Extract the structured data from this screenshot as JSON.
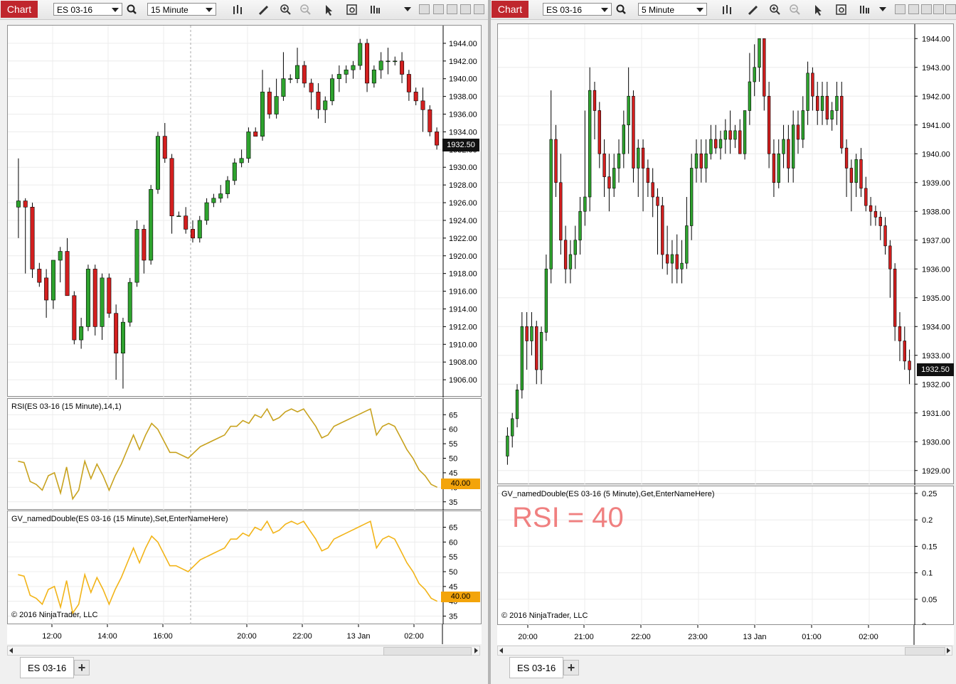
{
  "left": {
    "toolbar": {
      "chart_btn": "Chart",
      "instrument": "ES 03-16",
      "interval": "15 Minute"
    },
    "price_pane": {
      "ticks": [
        "1944.00",
        "1942.00",
        "1940.00",
        "1938.00",
        "1936.00",
        "1934.00",
        "1932.00",
        "1930.00",
        "1928.00",
        "1926.00",
        "1924.00",
        "1922.00",
        "1920.00",
        "1918.00",
        "1916.00",
        "1914.00",
        "1912.00",
        "1910.00",
        "1908.00",
        "1906.00"
      ],
      "last_price": "1932.50"
    },
    "rsi_pane": {
      "title": "RSI(ES 03-16 (15 Minute),14,1)",
      "ticks": [
        "65",
        "60",
        "55",
        "50",
        "45",
        "40",
        "35"
      ],
      "last": "40.00"
    },
    "gv_pane": {
      "title": "GV_namedDouble(ES 03-16 (15 Minute),Set,EnterNameHere)",
      "ticks": [
        "65",
        "60",
        "55",
        "50",
        "45",
        "40",
        "35"
      ],
      "last": "40.00",
      "copyright": "© 2016 NinjaTrader, LLC"
    },
    "time_labels": [
      "12:00",
      "14:00",
      "16:00",
      "20:00",
      "22:00",
      "13 Jan",
      "02:00"
    ],
    "tab": "ES 03-16",
    "add_tab": "+"
  },
  "right": {
    "toolbar": {
      "chart_btn": "Chart",
      "instrument": "ES 03-16",
      "interval": "5 Minute"
    },
    "price_pane": {
      "ticks": [
        "1944.00",
        "1943.00",
        "1942.00",
        "1941.00",
        "1940.00",
        "1939.00",
        "1938.00",
        "1937.00",
        "1936.00",
        "1935.00",
        "1934.00",
        "1933.00",
        "1932.00",
        "1931.00",
        "1930.00",
        "1929.00"
      ],
      "last_price": "1932.50"
    },
    "gv_pane": {
      "title": "GV_namedDouble(ES 03-16 (5 Minute),Get,EnterNameHere)",
      "ticks": [
        "0.25",
        "0.2",
        "0.15",
        "0.1",
        "0.05",
        "0"
      ],
      "annotation": "RSI = 40",
      "copyright": "© 2016 NinjaTrader, LLC"
    },
    "time_labels": [
      "20:00",
      "21:00",
      "22:00",
      "23:00",
      "13 Jan",
      "01:00",
      "02:00"
    ],
    "tab": "ES 03-16",
    "add_tab": "+"
  },
  "colors": {
    "up": "#2ea32e",
    "down": "#d31f1f",
    "rsi": "#c8a21e",
    "gv": "#f2b418",
    "marker": "#f3a40a",
    "annotation": "#f08080"
  },
  "chart_data": [
    {
      "type": "candlestick",
      "instrument": "ES 03-16",
      "interval": "15 Minute",
      "ylim": [
        1904,
        1946
      ],
      "candles": [
        [
          1925.5,
          1931.0,
          1922.0,
          1926.2
        ],
        [
          1926.2,
          1926.5,
          1918.0,
          1925.5
        ],
        [
          1925.5,
          1926.0,
          1917.5,
          1918.5
        ],
        [
          1918.5,
          1919.2,
          1916.5,
          1917.0
        ],
        [
          1917.5,
          1918.5,
          1913.0,
          1915.0
        ],
        [
          1915.0,
          1919.5,
          1914.0,
          1919.5
        ],
        [
          1919.5,
          1921.0,
          1917.0,
          1920.5
        ],
        [
          1920.5,
          1922.0,
          1919.0,
          1915.5
        ],
        [
          1915.5,
          1916.0,
          1910.0,
          1910.5
        ],
        [
          1910.5,
          1913.0,
          1909.5,
          1912.0
        ],
        [
          1912.0,
          1919.0,
          1911.5,
          1918.5
        ],
        [
          1918.5,
          1919.0,
          1911.0,
          1912.0
        ],
        [
          1912.0,
          1918.0,
          1910.5,
          1917.5
        ],
        [
          1917.5,
          1918.0,
          1913.0,
          1913.5
        ],
        [
          1913.5,
          1914.5,
          1906.0,
          1909.0
        ],
        [
          1909.0,
          1913.0,
          1905.0,
          1912.5
        ],
        [
          1912.5,
          1917.5,
          1912.0,
          1917.0
        ],
        [
          1917.0,
          1924.0,
          1916.5,
          1923.0
        ],
        [
          1923.0,
          1923.5,
          1918.0,
          1919.5
        ],
        [
          1919.5,
          1928.0,
          1919.0,
          1927.5
        ],
        [
          1927.5,
          1934.0,
          1927.0,
          1933.5
        ],
        [
          1933.5,
          1935.0,
          1930.5,
          1931.0
        ],
        [
          1931.0,
          1931.5,
          1922.5,
          1924.5
        ],
        [
          1924.5,
          1925.0,
          1924.5,
          1924.5
        ],
        [
          1924.5,
          1925.5,
          1922.5,
          1923.0
        ],
        [
          1923.0,
          1924.0,
          1921.5,
          1922.0
        ],
        [
          1922.0,
          1924.5,
          1921.5,
          1924.0
        ],
        [
          1924.0,
          1926.5,
          1923.5,
          1926.0
        ],
        [
          1926.0,
          1927.0,
          1925.5,
          1926.5
        ],
        [
          1926.5,
          1928.0,
          1926.0,
          1927.0
        ],
        [
          1927.0,
          1929.0,
          1926.5,
          1928.5
        ],
        [
          1928.5,
          1931.0,
          1928.0,
          1930.5
        ],
        [
          1930.5,
          1932.0,
          1930.0,
          1931.0
        ],
        [
          1931.0,
          1934.5,
          1930.5,
          1934.0
        ],
        [
          1934.0,
          1934.5,
          1933.5,
          1933.5
        ],
        [
          1933.5,
          1941.0,
          1933.0,
          1938.5
        ],
        [
          1938.5,
          1939.0,
          1935.5,
          1936.0
        ],
        [
          1936.0,
          1940.0,
          1935.5,
          1938.0
        ],
        [
          1938.0,
          1943.0,
          1937.5,
          1940.0
        ],
        [
          1940.0,
          1940.5,
          1939.5,
          1940.0
        ],
        [
          1940.0,
          1943.5,
          1939.5,
          1941.5
        ],
        [
          1941.5,
          1942.0,
          1939.0,
          1939.5
        ],
        [
          1939.5,
          1940.0,
          1936.5,
          1938.5
        ],
        [
          1938.5,
          1939.5,
          1935.5,
          1936.5
        ],
        [
          1936.5,
          1938.0,
          1935.0,
          1937.5
        ],
        [
          1937.5,
          1940.5,
          1937.0,
          1940.0
        ],
        [
          1940.0,
          1941.5,
          1938.5,
          1940.5
        ],
        [
          1940.5,
          1941.5,
          1939.5,
          1941.0
        ],
        [
          1941.0,
          1942.0,
          1940.0,
          1941.5
        ],
        [
          1941.5,
          1944.5,
          1941.0,
          1944.0
        ],
        [
          1944.0,
          1944.5,
          1938.5,
          1939.5
        ],
        [
          1939.5,
          1941.5,
          1939.0,
          1941.0
        ],
        [
          1941.0,
          1943.0,
          1940.0,
          1942.0
        ],
        [
          1942.0,
          1943.5,
          1940.5,
          1942.0
        ],
        [
          1942.0,
          1942.5,
          1941.5,
          1942.0
        ],
        [
          1942.0,
          1943.0,
          1939.5,
          1940.5
        ],
        [
          1940.5,
          1941.0,
          1937.5,
          1938.5
        ],
        [
          1938.5,
          1939.0,
          1937.0,
          1937.5
        ],
        [
          1937.5,
          1939.0,
          1934.0,
          1936.5
        ],
        [
          1936.5,
          1937.0,
          1933.5,
          1934.0
        ],
        [
          1934.0,
          1934.5,
          1932.0,
          1932.5
        ]
      ]
    },
    {
      "type": "line",
      "name": "RSI(ES 03-16 (15 Minute),14,1)",
      "ylim": [
        32,
        68
      ],
      "values": [
        49,
        48.5,
        42,
        41,
        39,
        44,
        45,
        38,
        47,
        36,
        39,
        49,
        43,
        48,
        44,
        39,
        44,
        48,
        53,
        58,
        53,
        58,
        62,
        60,
        56,
        52,
        52,
        51,
        50,
        52,
        54,
        55,
        56,
        57,
        58,
        61,
        61,
        63,
        62,
        65,
        64,
        67,
        63,
        64,
        66,
        67,
        66,
        67,
        64,
        61,
        57,
        58,
        61,
        62,
        63,
        64,
        65,
        66,
        67,
        58,
        61,
        62,
        61,
        57,
        53,
        50,
        46,
        44,
        41,
        40
      ]
    },
    {
      "type": "line",
      "name": "GV_namedDouble(ES 03-16 (15 Minute),Set,EnterNameHere)",
      "ylim": [
        32,
        68
      ],
      "values": [
        49,
        48.5,
        42,
        41,
        39,
        44,
        45,
        38,
        47,
        36,
        39,
        49,
        43,
        48,
        44,
        39,
        44,
        48,
        53,
        58,
        53,
        58,
        62,
        60,
        56,
        52,
        52,
        51,
        50,
        52,
        54,
        55,
        56,
        57,
        58,
        61,
        61,
        63,
        62,
        65,
        64,
        67,
        63,
        64,
        66,
        67,
        66,
        67,
        64,
        61,
        57,
        58,
        61,
        62,
        63,
        64,
        65,
        66,
        67,
        58,
        61,
        62,
        61,
        57,
        53,
        50,
        46,
        44,
        41,
        40
      ]
    },
    {
      "type": "candlestick",
      "instrument": "ES 03-16",
      "interval": "5 Minute",
      "ylim": [
        1928.5,
        1944.5
      ],
      "candles": [
        [
          1929.5,
          1930.5,
          1929.2,
          1930.2
        ],
        [
          1930.2,
          1931.0,
          1929.8,
          1930.8
        ],
        [
          1930.8,
          1932.0,
          1930.5,
          1931.8
        ],
        [
          1931.8,
          1934.5,
          1931.5,
          1934.0
        ],
        [
          1934.0,
          1934.5,
          1932.5,
          1933.5
        ],
        [
          1933.5,
          1934.5,
          1933.0,
          1934.0
        ],
        [
          1934.0,
          1934.2,
          1932.0,
          1932.5
        ],
        [
          1932.5,
          1934.0,
          1932.0,
          1933.8
        ],
        [
          1933.8,
          1936.5,
          1933.5,
          1936.0
        ],
        [
          1936.0,
          1942.2,
          1935.5,
          1940.5
        ],
        [
          1940.5,
          1941.0,
          1938.5,
          1939.0
        ],
        [
          1939.0,
          1940.0,
          1936.5,
          1937.0
        ],
        [
          1937.0,
          1937.5,
          1935.5,
          1936.0
        ],
        [
          1936.0,
          1937.0,
          1935.5,
          1936.5
        ],
        [
          1936.5,
          1937.5,
          1936.0,
          1937.0
        ],
        [
          1937.0,
          1938.5,
          1936.5,
          1938.0
        ],
        [
          1938.0,
          1941.5,
          1937.5,
          1938.5
        ],
        [
          1938.5,
          1943.0,
          1938.0,
          1942.2
        ],
        [
          1942.2,
          1942.5,
          1940.5,
          1941.5
        ],
        [
          1941.5,
          1941.8,
          1939.5,
          1940.0
        ],
        [
          1940.0,
          1940.5,
          1938.5,
          1939.2
        ],
        [
          1939.2,
          1940.0,
          1938.0,
          1938.8
        ],
        [
          1938.8,
          1940.0,
          1938.5,
          1939.5
        ],
        [
          1939.5,
          1940.5,
          1939.0,
          1940.0
        ],
        [
          1940.0,
          1941.5,
          1939.5,
          1941.0
        ],
        [
          1941.0,
          1943.0,
          1940.0,
          1942.0
        ],
        [
          1942.0,
          1942.2,
          1939.0,
          1939.5
        ],
        [
          1939.5,
          1940.5,
          1938.5,
          1940.2
        ],
        [
          1940.2,
          1940.5,
          1938.0,
          1939.5
        ],
        [
          1939.5,
          1939.8,
          1938.5,
          1939.0
        ],
        [
          1939.0,
          1939.5,
          1937.8,
          1938.5
        ],
        [
          1938.5,
          1938.8,
          1936.5,
          1938.2
        ],
        [
          1938.2,
          1938.5,
          1936.0,
          1936.5
        ],
        [
          1936.5,
          1937.5,
          1935.8,
          1936.2
        ],
        [
          1936.2,
          1937.0,
          1935.5,
          1936.5
        ],
        [
          1936.5,
          1937.2,
          1935.5,
          1936.0
        ],
        [
          1936.0,
          1937.0,
          1935.5,
          1936.2
        ],
        [
          1936.2,
          1938.5,
          1936.0,
          1937.5
        ],
        [
          1937.5,
          1940.0,
          1937.0,
          1939.5
        ],
        [
          1939.5,
          1940.5,
          1939.0,
          1940.0
        ],
        [
          1940.0,
          1940.5,
          1939.0,
          1939.5
        ],
        [
          1939.5,
          1940.5,
          1939.0,
          1940.0
        ],
        [
          1940.0,
          1941.0,
          1939.8,
          1940.5
        ],
        [
          1940.5,
          1941.0,
          1940.0,
          1940.2
        ],
        [
          1940.2,
          1940.8,
          1939.8,
          1940.5
        ],
        [
          1940.5,
          1941.2,
          1940.0,
          1940.8
        ],
        [
          1940.8,
          1941.5,
          1940.0,
          1940.5
        ],
        [
          1940.5,
          1941.0,
          1940.2,
          1940.8
        ],
        [
          1940.8,
          1941.2,
          1940.0,
          1940.0
        ],
        [
          1940.0,
          1941.5,
          1939.8,
          1941.5
        ],
        [
          1941.5,
          1943.5,
          1941.0,
          1942.5
        ],
        [
          1942.5,
          1943.8,
          1942.0,
          1943.0
        ],
        [
          1943.0,
          1944.0,
          1942.5,
          1944.0
        ],
        [
          1944.0,
          1944.0,
          1941.5,
          1942.0
        ],
        [
          1942.0,
          1942.5,
          1939.5,
          1940.0
        ],
        [
          1940.0,
          1940.5,
          1938.5,
          1939.0
        ],
        [
          1939.0,
          1940.5,
          1938.8,
          1940.0
        ],
        [
          1940.0,
          1941.0,
          1939.5,
          1940.5
        ],
        [
          1940.5,
          1941.0,
          1939.0,
          1939.5
        ],
        [
          1939.5,
          1941.5,
          1939.0,
          1941.0
        ],
        [
          1941.0,
          1941.5,
          1940.0,
          1940.5
        ],
        [
          1940.5,
          1942.0,
          1940.2,
          1941.5
        ],
        [
          1941.5,
          1943.2,
          1941.0,
          1942.8
        ],
        [
          1942.8,
          1943.0,
          1941.5,
          1942.0
        ],
        [
          1942.0,
          1942.5,
          1941.0,
          1941.5
        ],
        [
          1941.5,
          1942.5,
          1941.0,
          1942.0
        ],
        [
          1942.0,
          1942.5,
          1941.0,
          1941.2
        ],
        [
          1941.2,
          1941.8,
          1940.8,
          1941.5
        ],
        [
          1941.5,
          1942.5,
          1941.0,
          1942.0
        ],
        [
          1942.0,
          1942.5,
          1940.0,
          1940.2
        ],
        [
          1940.2,
          1940.5,
          1938.5,
          1939.5
        ],
        [
          1939.5,
          1939.8,
          1938.0,
          1939.0
        ],
        [
          1939.0,
          1940.0,
          1938.5,
          1939.8
        ],
        [
          1939.8,
          1940.2,
          1938.5,
          1938.8
        ],
        [
          1938.8,
          1939.2,
          1938.0,
          1938.2
        ],
        [
          1938.2,
          1938.5,
          1937.5,
          1938.0
        ],
        [
          1938.0,
          1938.2,
          1937.5,
          1937.8
        ],
        [
          1937.8,
          1938.0,
          1937.0,
          1937.5
        ],
        [
          1937.5,
          1937.8,
          1936.5,
          1936.8
        ],
        [
          1936.8,
          1937.0,
          1935.0,
          1936.0
        ],
        [
          1936.0,
          1936.2,
          1933.5,
          1934.0
        ],
        [
          1934.0,
          1934.5,
          1932.8,
          1933.5
        ],
        [
          1933.5,
          1934.0,
          1932.5,
          1932.8
        ],
        [
          1932.8,
          1933.2,
          1932.0,
          1932.5
        ]
      ]
    },
    {
      "type": "line",
      "name": "GV_namedDouble(ES 03-16 (5 Minute),Get,EnterNameHere)",
      "ylim": [
        0,
        0.25
      ],
      "values": []
    }
  ]
}
